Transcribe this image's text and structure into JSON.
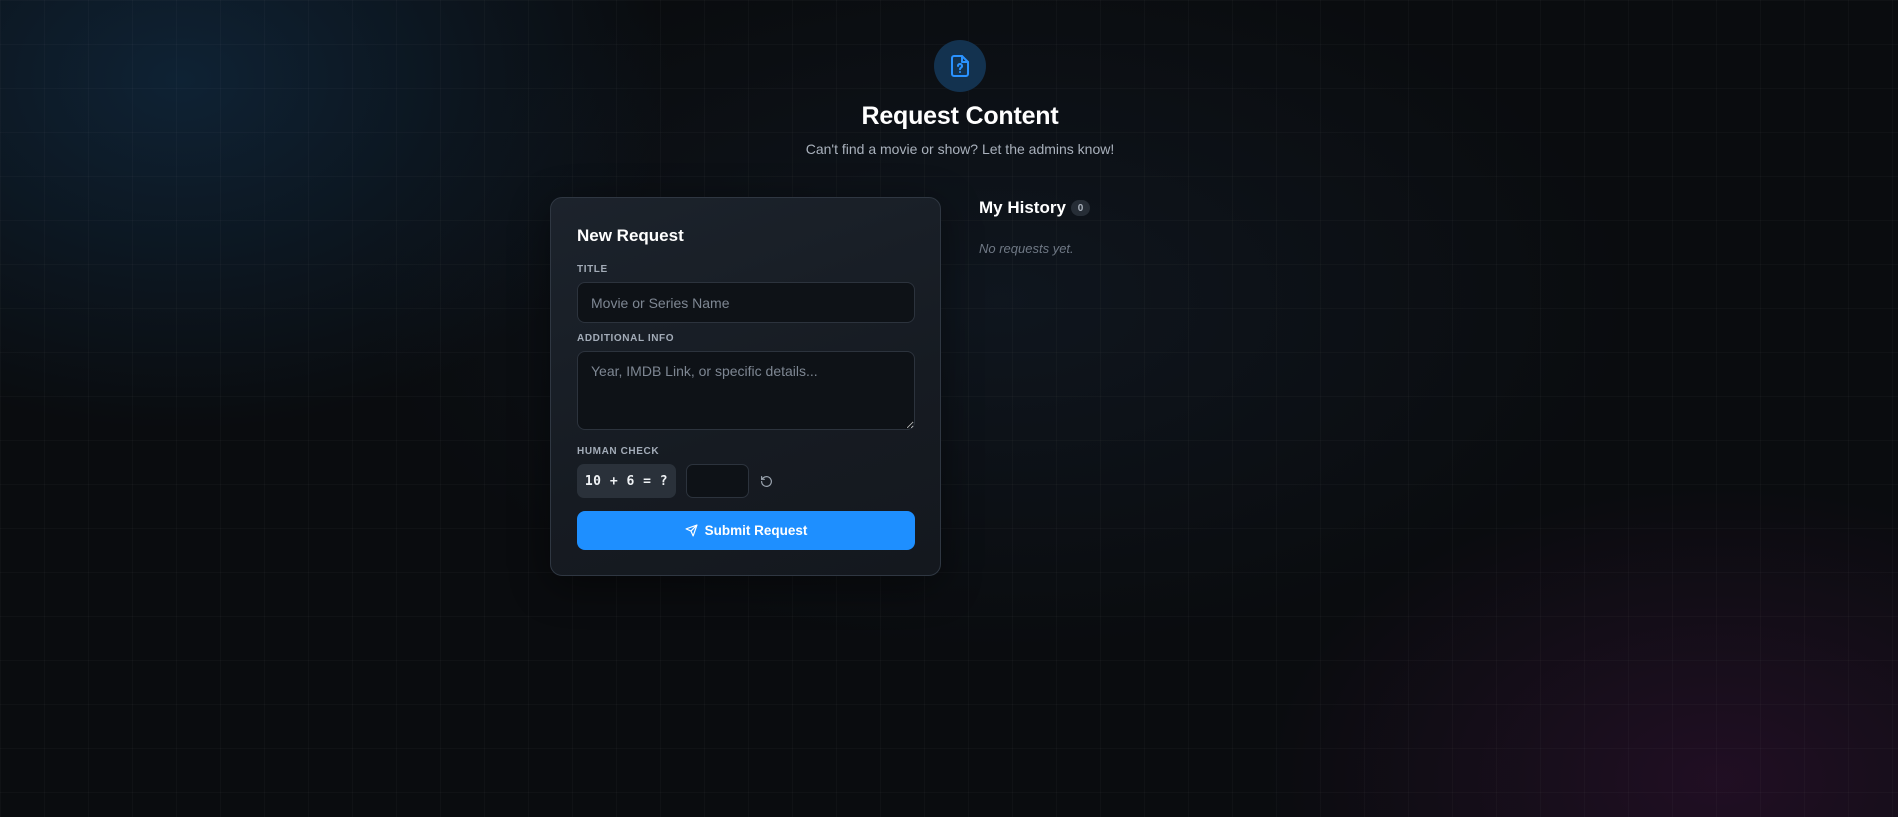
{
  "header": {
    "icon": "file-question-icon",
    "title": "Request Content",
    "subtitle": "Can't find a movie or show? Let the admins know!"
  },
  "form": {
    "title": "New Request",
    "title_field": {
      "label": "TITLE",
      "placeholder": "Movie or Series Name",
      "value": ""
    },
    "info_field": {
      "label": "ADDITIONAL INFO",
      "placeholder": "Year, IMDB Link, or specific details...",
      "value": ""
    },
    "captcha": {
      "label": "HUMAN CHECK",
      "question": "10 + 6 = ?",
      "answer": "",
      "refresh_icon": "refresh-icon"
    },
    "submit": {
      "icon": "send-icon",
      "label": "Submit Request"
    }
  },
  "history": {
    "title": "My History",
    "count": "0",
    "empty_text": "No requests yet."
  },
  "colors": {
    "accent": "#1e8fff",
    "background": "#0a0c0f",
    "card": "#181d24"
  }
}
